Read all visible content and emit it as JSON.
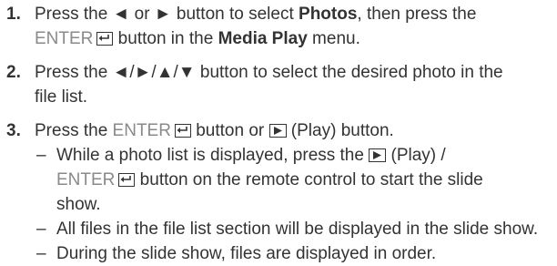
{
  "steps": [
    {
      "number": "1.",
      "text_a": "Press the ◄ or ► button to select ",
      "bold_a": "Photos",
      "text_b": ", then press the",
      "enter_label": "ENTER",
      "text_c": " button in the ",
      "bold_b": "Media Play",
      "text_d": " menu."
    },
    {
      "number": "2.",
      "text_a": "Press the ◄/►/▲/▼ button to select the desired photo in the",
      "text_b": "file list."
    },
    {
      "number": "3.",
      "text_a": "Press the ",
      "enter_label": "ENTER",
      "text_b": " button or ",
      "text_c": " (Play) button.",
      "sub_items": [
        {
          "dash": "–",
          "text_a": "While a photo list is displayed, press the ",
          "text_b": " (Play) /",
          "enter_label": "ENTER",
          "text_c": " button on the remote control to start the slide",
          "text_d": "show."
        },
        {
          "dash": "–",
          "text": "All files in the file list section will be displayed in the slide show."
        },
        {
          "dash": "–",
          "text": "During the slide show, files are displayed in order."
        }
      ]
    }
  ],
  "icons": {
    "enter": "enter-key-icon",
    "play": "play-button-icon"
  },
  "colors": {
    "text": "#333333",
    "button_label": "#8a8a8a"
  }
}
